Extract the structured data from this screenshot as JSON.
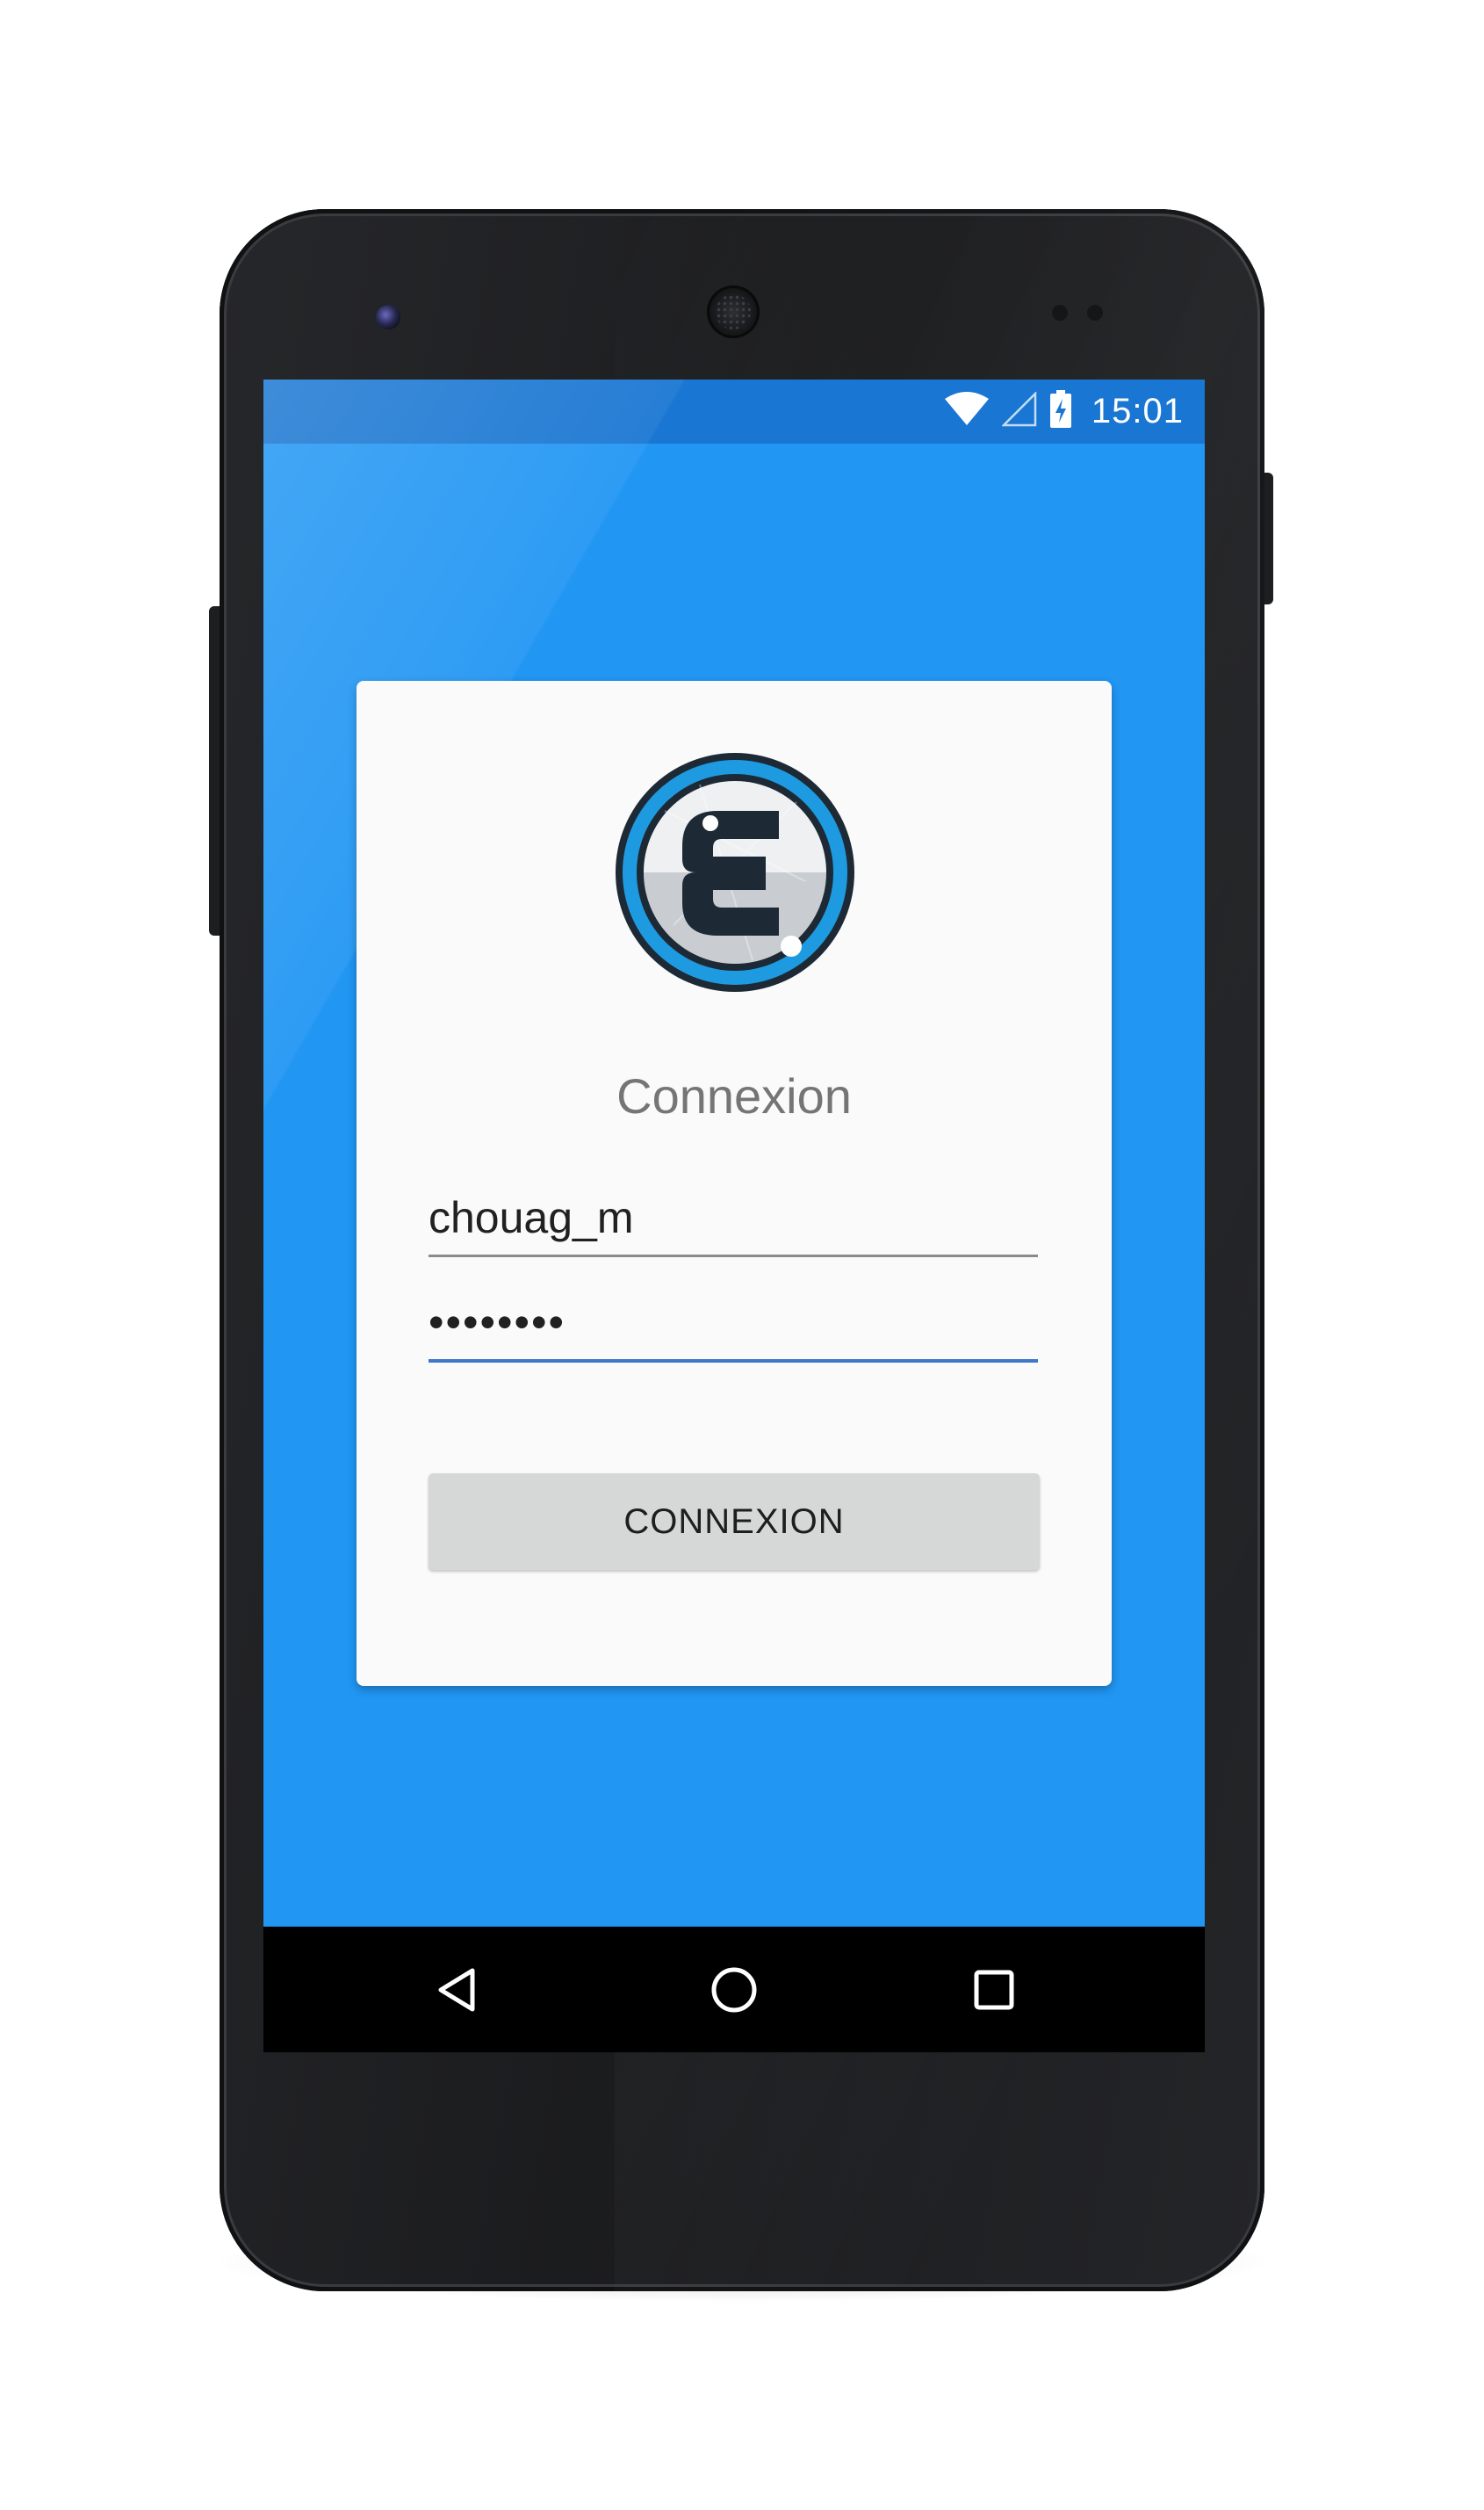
{
  "status_bar": {
    "time": "15:01",
    "icons": [
      "wifi-icon",
      "cell-signal-icon",
      "battery-charging-icon"
    ]
  },
  "login": {
    "title": "Connexion",
    "username_value": "chouag_m",
    "password_value": "••••••••",
    "button_label": "CONNEXION",
    "logo_icon": "e-logo-icon"
  },
  "nav_bar": {
    "icons": [
      "back-icon",
      "home-icon",
      "recents-icon"
    ]
  },
  "colors": {
    "screen_background": "#2196f3",
    "status_bar": "#1976d2",
    "card_background": "#fafafa",
    "title_text": "#757575",
    "button_background": "#d6d7d7",
    "field_focus_underline": "#3f78c9",
    "logo_ring": "#1e9be0",
    "logo_dark": "#1d2a36"
  }
}
